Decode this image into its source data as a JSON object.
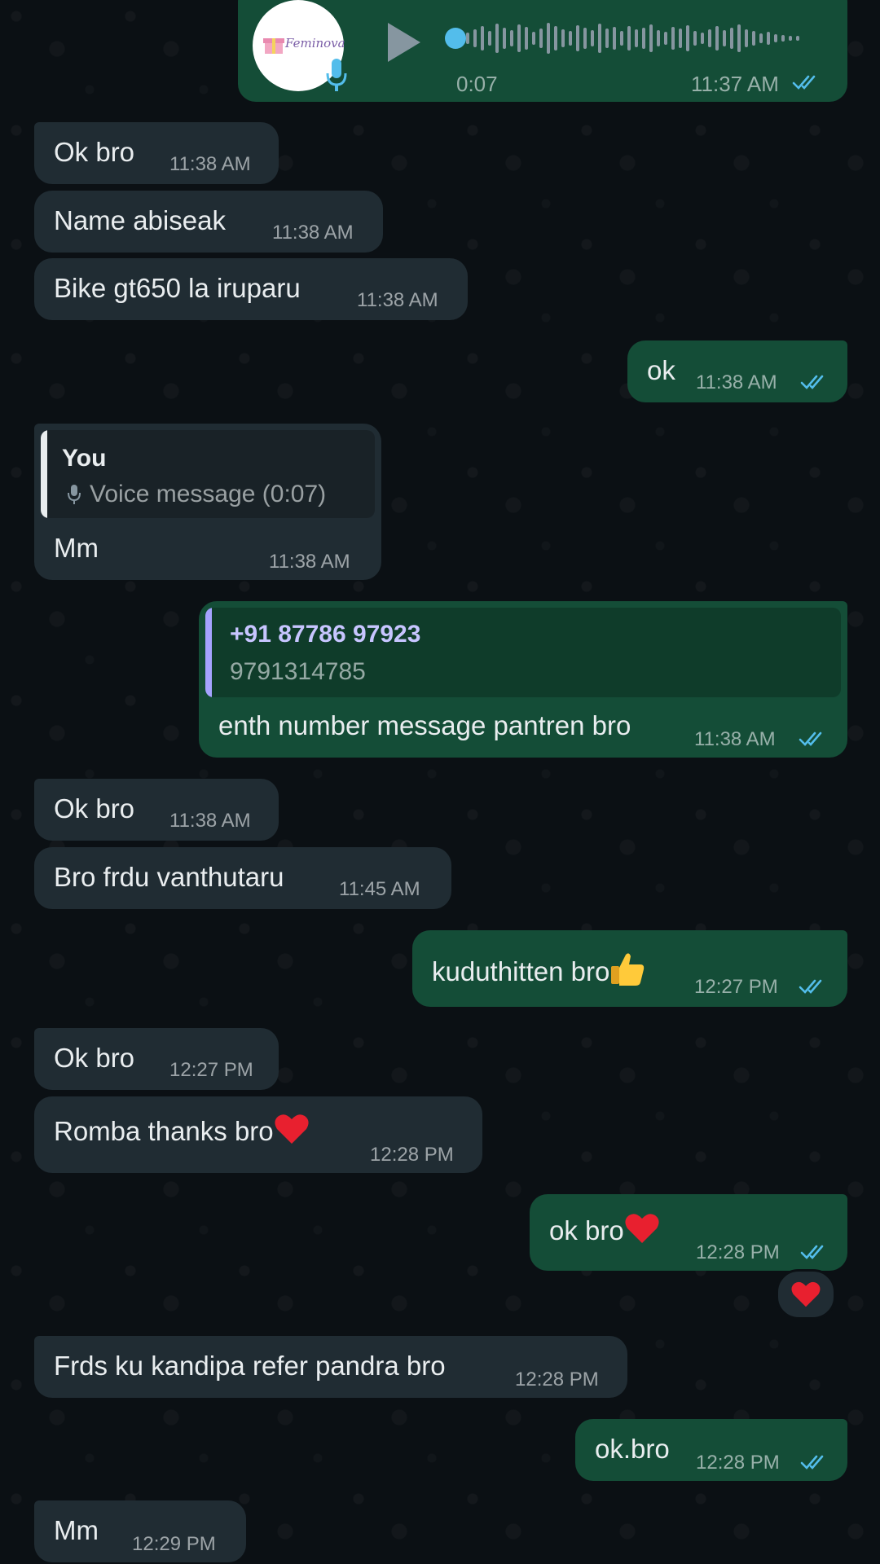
{
  "voice_note": {
    "avatar_text": "Feminova",
    "duration": "0:07",
    "time": "11:37 AM"
  },
  "messages": [
    {
      "dir": "in",
      "text": "Ok bro",
      "time": "11:38 AM"
    },
    {
      "dir": "in",
      "text": "Name abiseak",
      "time": "11:38 AM"
    },
    {
      "dir": "in",
      "text": "Bike gt650 la iruparu",
      "time": "11:38 AM"
    },
    {
      "dir": "out",
      "text": "ok",
      "time": "11:38 AM"
    },
    {
      "dir": "in",
      "quote_author": "You",
      "quote_text": "Voice message (0:07)",
      "text": "Mm",
      "time": "11:38 AM"
    },
    {
      "dir": "out",
      "quote_author": "+91 87786 97923",
      "quote_text": "9791314785",
      "text": "enth number message pantren bro",
      "time": "11:38 AM"
    },
    {
      "dir": "in",
      "text": "Ok bro",
      "time": "11:38 AM"
    },
    {
      "dir": "in",
      "text": "Bro frdu vanthutaru",
      "time": "11:45 AM"
    },
    {
      "dir": "out",
      "text": "kuduthitten bro",
      "emoji": "thumbs-up",
      "time": "12:27 PM"
    },
    {
      "dir": "in",
      "text": "Ok bro",
      "time": "12:27 PM"
    },
    {
      "dir": "in",
      "text": "Romba thanks bro",
      "emoji": "red-heart",
      "time": "12:28 PM"
    },
    {
      "dir": "out",
      "text": "ok bro",
      "emoji": "red-heart",
      "time": "12:28 PM",
      "reaction": "red-heart"
    },
    {
      "dir": "in",
      "text": "Frds ku kandipa refer pandra bro",
      "time": "12:28 PM"
    },
    {
      "dir": "out",
      "text": "ok.bro",
      "time": "12:28 PM"
    },
    {
      "dir": "in",
      "text": "Mm",
      "time": "12:29 PM"
    }
  ],
  "colors": {
    "incoming_bubble": "#202c33",
    "outgoing_bubble": "#144d37",
    "read_ticks": "#53bdeb",
    "quote_you": "#e9edef",
    "quote_contact": "#a5a3ff"
  }
}
